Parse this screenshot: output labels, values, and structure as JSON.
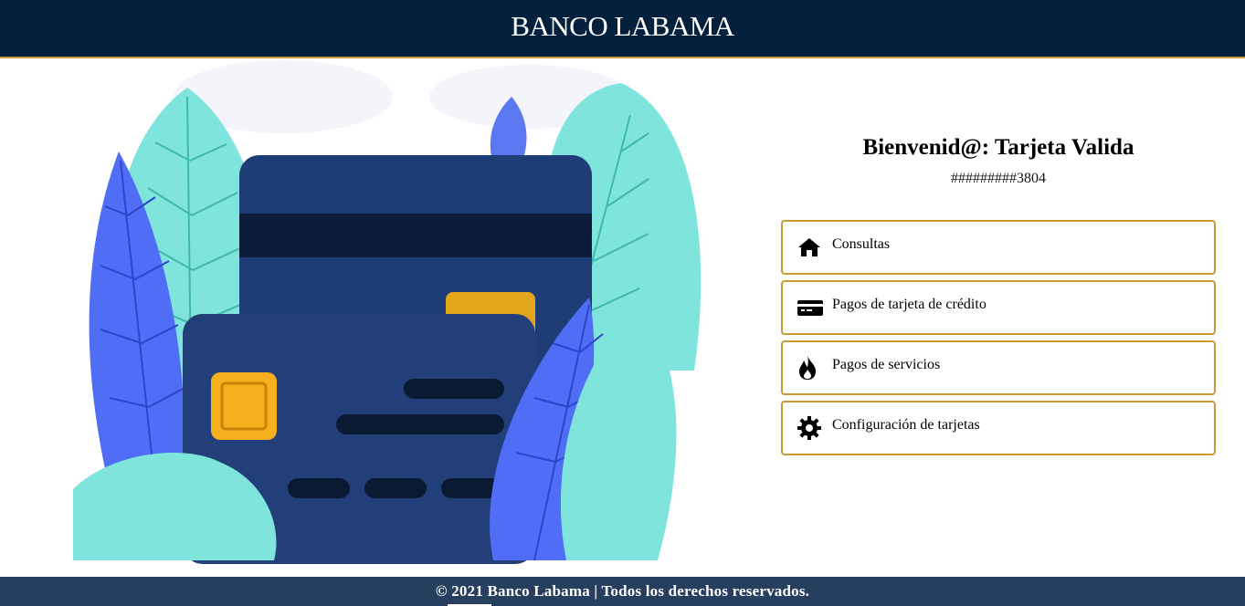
{
  "header": {
    "title": "BANCO LABAMA"
  },
  "welcome": {
    "title": "Bienvenid@: Tarjeta Valida",
    "card_number": "#########3804"
  },
  "menu": {
    "items": [
      {
        "label": "Consultas",
        "icon": "home-icon"
      },
      {
        "label": "Pagos de tarjeta de crédito",
        "icon": "credit-card-icon"
      },
      {
        "label": "Pagos de servicios",
        "icon": "fire-icon"
      },
      {
        "label": "Configuración de tarjetas",
        "icon": "gear-icon"
      }
    ]
  },
  "footer": {
    "text": "© 2021 Banco Labama | Todos los derechos reservados."
  },
  "colors": {
    "header_bg": "#03203c",
    "accent_gold": "#c89b34",
    "footer_bg": "#263f5e"
  }
}
